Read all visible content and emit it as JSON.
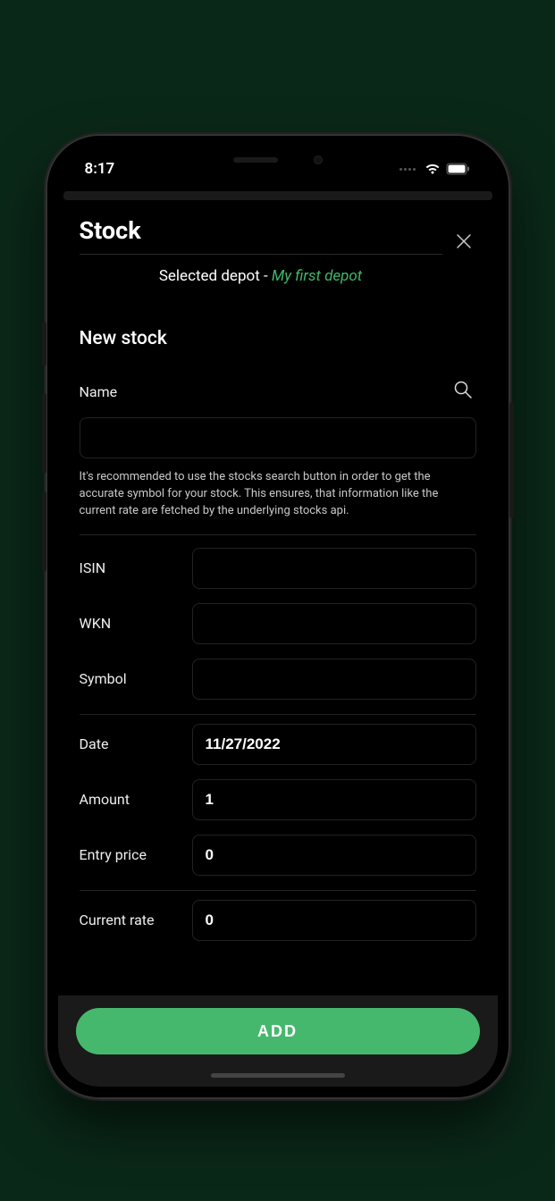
{
  "status": {
    "time": "8:17"
  },
  "header": {
    "title": "Stock",
    "selected_label": "Selected depot",
    "separator": "  -  ",
    "depot_name": "My first depot"
  },
  "section": {
    "title": "New stock"
  },
  "name": {
    "label": "Name",
    "value": ""
  },
  "helper_text": "It's recommended to use the stocks search button in order to get the accurate symbol for your stock. This ensures, that information like the current rate are fetched by the underlying stocks api.",
  "fields": {
    "isin": {
      "label": "ISIN",
      "value": ""
    },
    "wkn": {
      "label": "WKN",
      "value": ""
    },
    "symbol": {
      "label": "Symbol",
      "value": ""
    },
    "date": {
      "label": "Date",
      "value": "11/27/2022"
    },
    "amount": {
      "label": "Amount",
      "value": "1"
    },
    "entry_price": {
      "label": "Entry price",
      "value": "0"
    },
    "current_rate": {
      "label": "Current rate",
      "value": "0"
    }
  },
  "footer": {
    "add_label": "ADD"
  },
  "colors": {
    "accent": "#46b86e",
    "accent_text": "#3fb86a"
  }
}
